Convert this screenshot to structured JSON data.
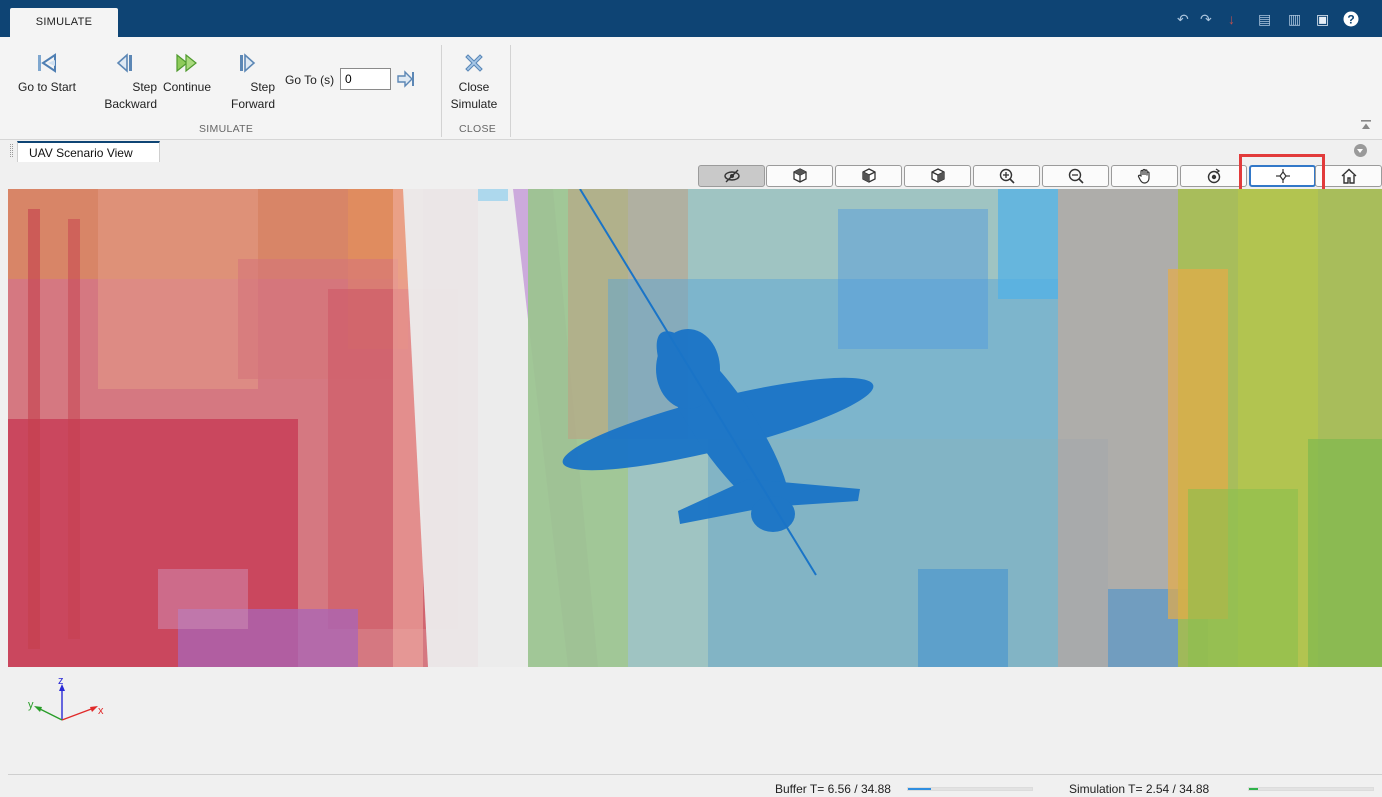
{
  "tabstrip": {
    "active_tab": "SIMULATE"
  },
  "quick_access": [
    "undo-icon",
    "redo-icon",
    "pin-icon",
    "copy-icon",
    "paste-icon",
    "save-icon",
    "help-icon"
  ],
  "ribbon": {
    "buttons": {
      "go_to_start": "Go to Start",
      "step_backward": "Step\nBackward",
      "continue": "Continue",
      "step_forward": "Step\nForward",
      "close_simulate": "Close\nSimulate"
    },
    "goto_label": "Go To (s)",
    "goto_value": "0",
    "groups": {
      "simulate": "SIMULATE",
      "close": "CLOSE"
    }
  },
  "document": {
    "tab_label": "UAV Scenario View"
  },
  "view_toolbar": {
    "buttons": [
      {
        "name": "hide-icon",
        "state": "pressed"
      },
      {
        "name": "cube-view-icon",
        "state": "normal"
      },
      {
        "name": "cube-side-icon",
        "state": "normal"
      },
      {
        "name": "cube-back-icon",
        "state": "normal"
      },
      {
        "name": "zoom-in-icon",
        "state": "normal"
      },
      {
        "name": "zoom-out-icon",
        "state": "normal"
      },
      {
        "name": "pan-hand-icon",
        "state": "normal"
      },
      {
        "name": "rotate-icon",
        "state": "normal"
      },
      {
        "name": "aircraft-follow-icon",
        "state": "active"
      },
      {
        "name": "home-icon",
        "state": "normal"
      }
    ]
  },
  "axes": {
    "z": "z",
    "y": "y",
    "x": "x"
  },
  "colors": {
    "accent": "#0e4474",
    "uav": "#1a74c7",
    "highlight": "#e23b3b",
    "buffer": "#2f8ee0",
    "simulation": "#2fb34a"
  },
  "status": {
    "buffer_text": "Buffer T= 6.56 / 34.88",
    "buffer_fraction": 0.188,
    "simulation_text": "Simulation T= 2.54 / 34.88",
    "simulation_fraction": 0.073
  }
}
